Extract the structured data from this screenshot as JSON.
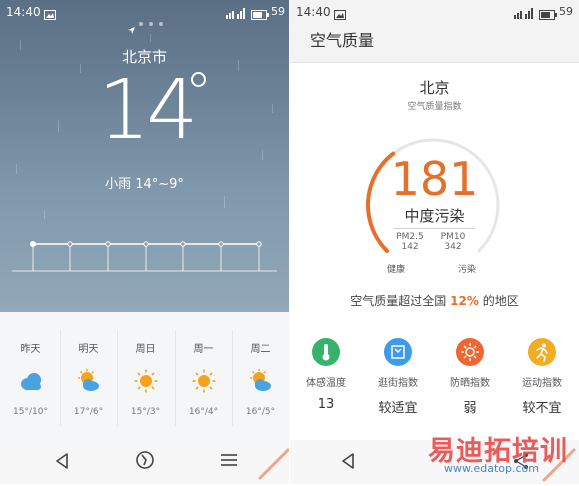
{
  "left": {
    "status_bar": {
      "time": "14:40",
      "battery": "59"
    },
    "city": "北京市",
    "temperature": "14",
    "condition": "小雨 14°~9°",
    "forecast": [
      {
        "day": "昨天",
        "icon": "cloud-icon",
        "temp": "15°/10°"
      },
      {
        "day": "明天",
        "icon": "partly-cloudy-icon",
        "temp": "17°/6°"
      },
      {
        "day": "周日",
        "icon": "sun-icon",
        "temp": "15°/3°"
      },
      {
        "day": "周一",
        "icon": "sun-icon",
        "temp": "16°/4°"
      },
      {
        "day": "周二",
        "icon": "partly-cloudy-icon",
        "temp": "16°/5°"
      }
    ]
  },
  "right": {
    "status_bar": {
      "time": "14:40",
      "battery": "59"
    },
    "title": "空气质量",
    "city": "北京",
    "subtitle": "空气质量指数",
    "aqi": "181",
    "aqi_fraction": 0.36,
    "level": "中度污染",
    "pm25": {
      "label": "PM2.5",
      "value": "142"
    },
    "pm10": {
      "label": "PM10",
      "value": "342"
    },
    "scale_start": "健康",
    "scale_end": "污染",
    "compare_prefix": "空气质量超过全国",
    "compare_percent": "12%",
    "compare_suffix": "的地区",
    "indices": [
      {
        "name": "体感温度",
        "value": "13",
        "icon": "thermometer-icon",
        "color": "#36b36a"
      },
      {
        "name": "逛街指数",
        "value": "较适宜",
        "icon": "shopping-bag-icon",
        "color": "#3d9be9"
      },
      {
        "name": "防晒指数",
        "value": "弱",
        "icon": "sun-icon",
        "color": "#f0662f"
      },
      {
        "name": "运动指数",
        "value": "较不宜",
        "icon": "runner-icon",
        "color": "#f3ad22"
      }
    ]
  },
  "watermark": {
    "text": "易迪拓培训",
    "url": "www.edatop.com"
  },
  "colors": {
    "accent": "#e56f2c",
    "sky": "#6d8398"
  }
}
